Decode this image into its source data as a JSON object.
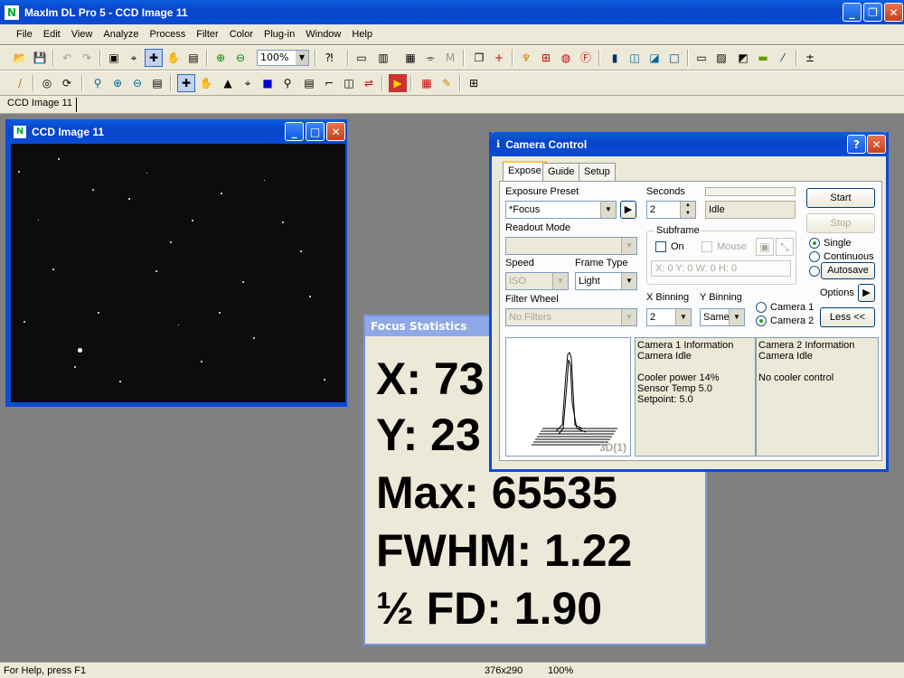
{
  "app": {
    "title": "MaxIm DL Pro 5 - CCD Image 11"
  },
  "menu": [
    "File",
    "Edit",
    "View",
    "Analyze",
    "Process",
    "Filter",
    "Color",
    "Plug-in",
    "Window",
    "Help"
  ],
  "toolbar": {
    "zoom_value": "100%"
  },
  "doc_tab": "CCD Image 11",
  "ccd_window": {
    "title": "CCD Image 11"
  },
  "focus_stats": {
    "title": "Focus Statistics",
    "x": "X: 73",
    "y": "Y: 23",
    "max": "Max: 65535",
    "fwhm": "FWHM: 1.22",
    "hfd": "½ FD: 1.90"
  },
  "camera": {
    "title": "Camera Control",
    "tabs": [
      "Expose",
      "Guide",
      "Setup"
    ],
    "exposure_preset_label": "Exposure Preset",
    "exposure_preset_value": "*Focus",
    "seconds_label": "Seconds",
    "seconds_value": "2",
    "status": "Idle",
    "readout_label": "Readout Mode",
    "readout_value": "",
    "subframe_label": "Subframe",
    "on_label": "On",
    "mouse_label": "Mouse",
    "subframe_coords": "X:  0 Y:  0 W:  0 H:  0",
    "speed_label": "Speed",
    "speed_value": "ISO",
    "frame_type_label": "Frame Type",
    "frame_type_value": "Light",
    "filter_label": "Filter Wheel",
    "filter_value": "No Filters",
    "xbin_label": "X Binning",
    "xbin_value": "2",
    "ybin_label": "Y Binning",
    "ybin_value": "Same",
    "start": "Start",
    "stop": "Stop",
    "single": "Single",
    "continuous": "Continuous",
    "autosave": "Autosave",
    "options": "Options",
    "camera1": "Camera 1",
    "camera2": "Camera 2",
    "less": "Less <<",
    "graph_label": "3D(1)",
    "cam1_info": [
      "Camera 1 Information",
      "Camera Idle",
      "",
      "Cooler power 14%",
      "Sensor Temp 5.0",
      "Setpoint: 5.0"
    ],
    "cam2_info": [
      "Camera 2 Information",
      "Camera Idle",
      "",
      "No cooler control"
    ]
  },
  "status": {
    "help": "For Help, press F1",
    "size": "376x290",
    "zoom": "100%"
  }
}
